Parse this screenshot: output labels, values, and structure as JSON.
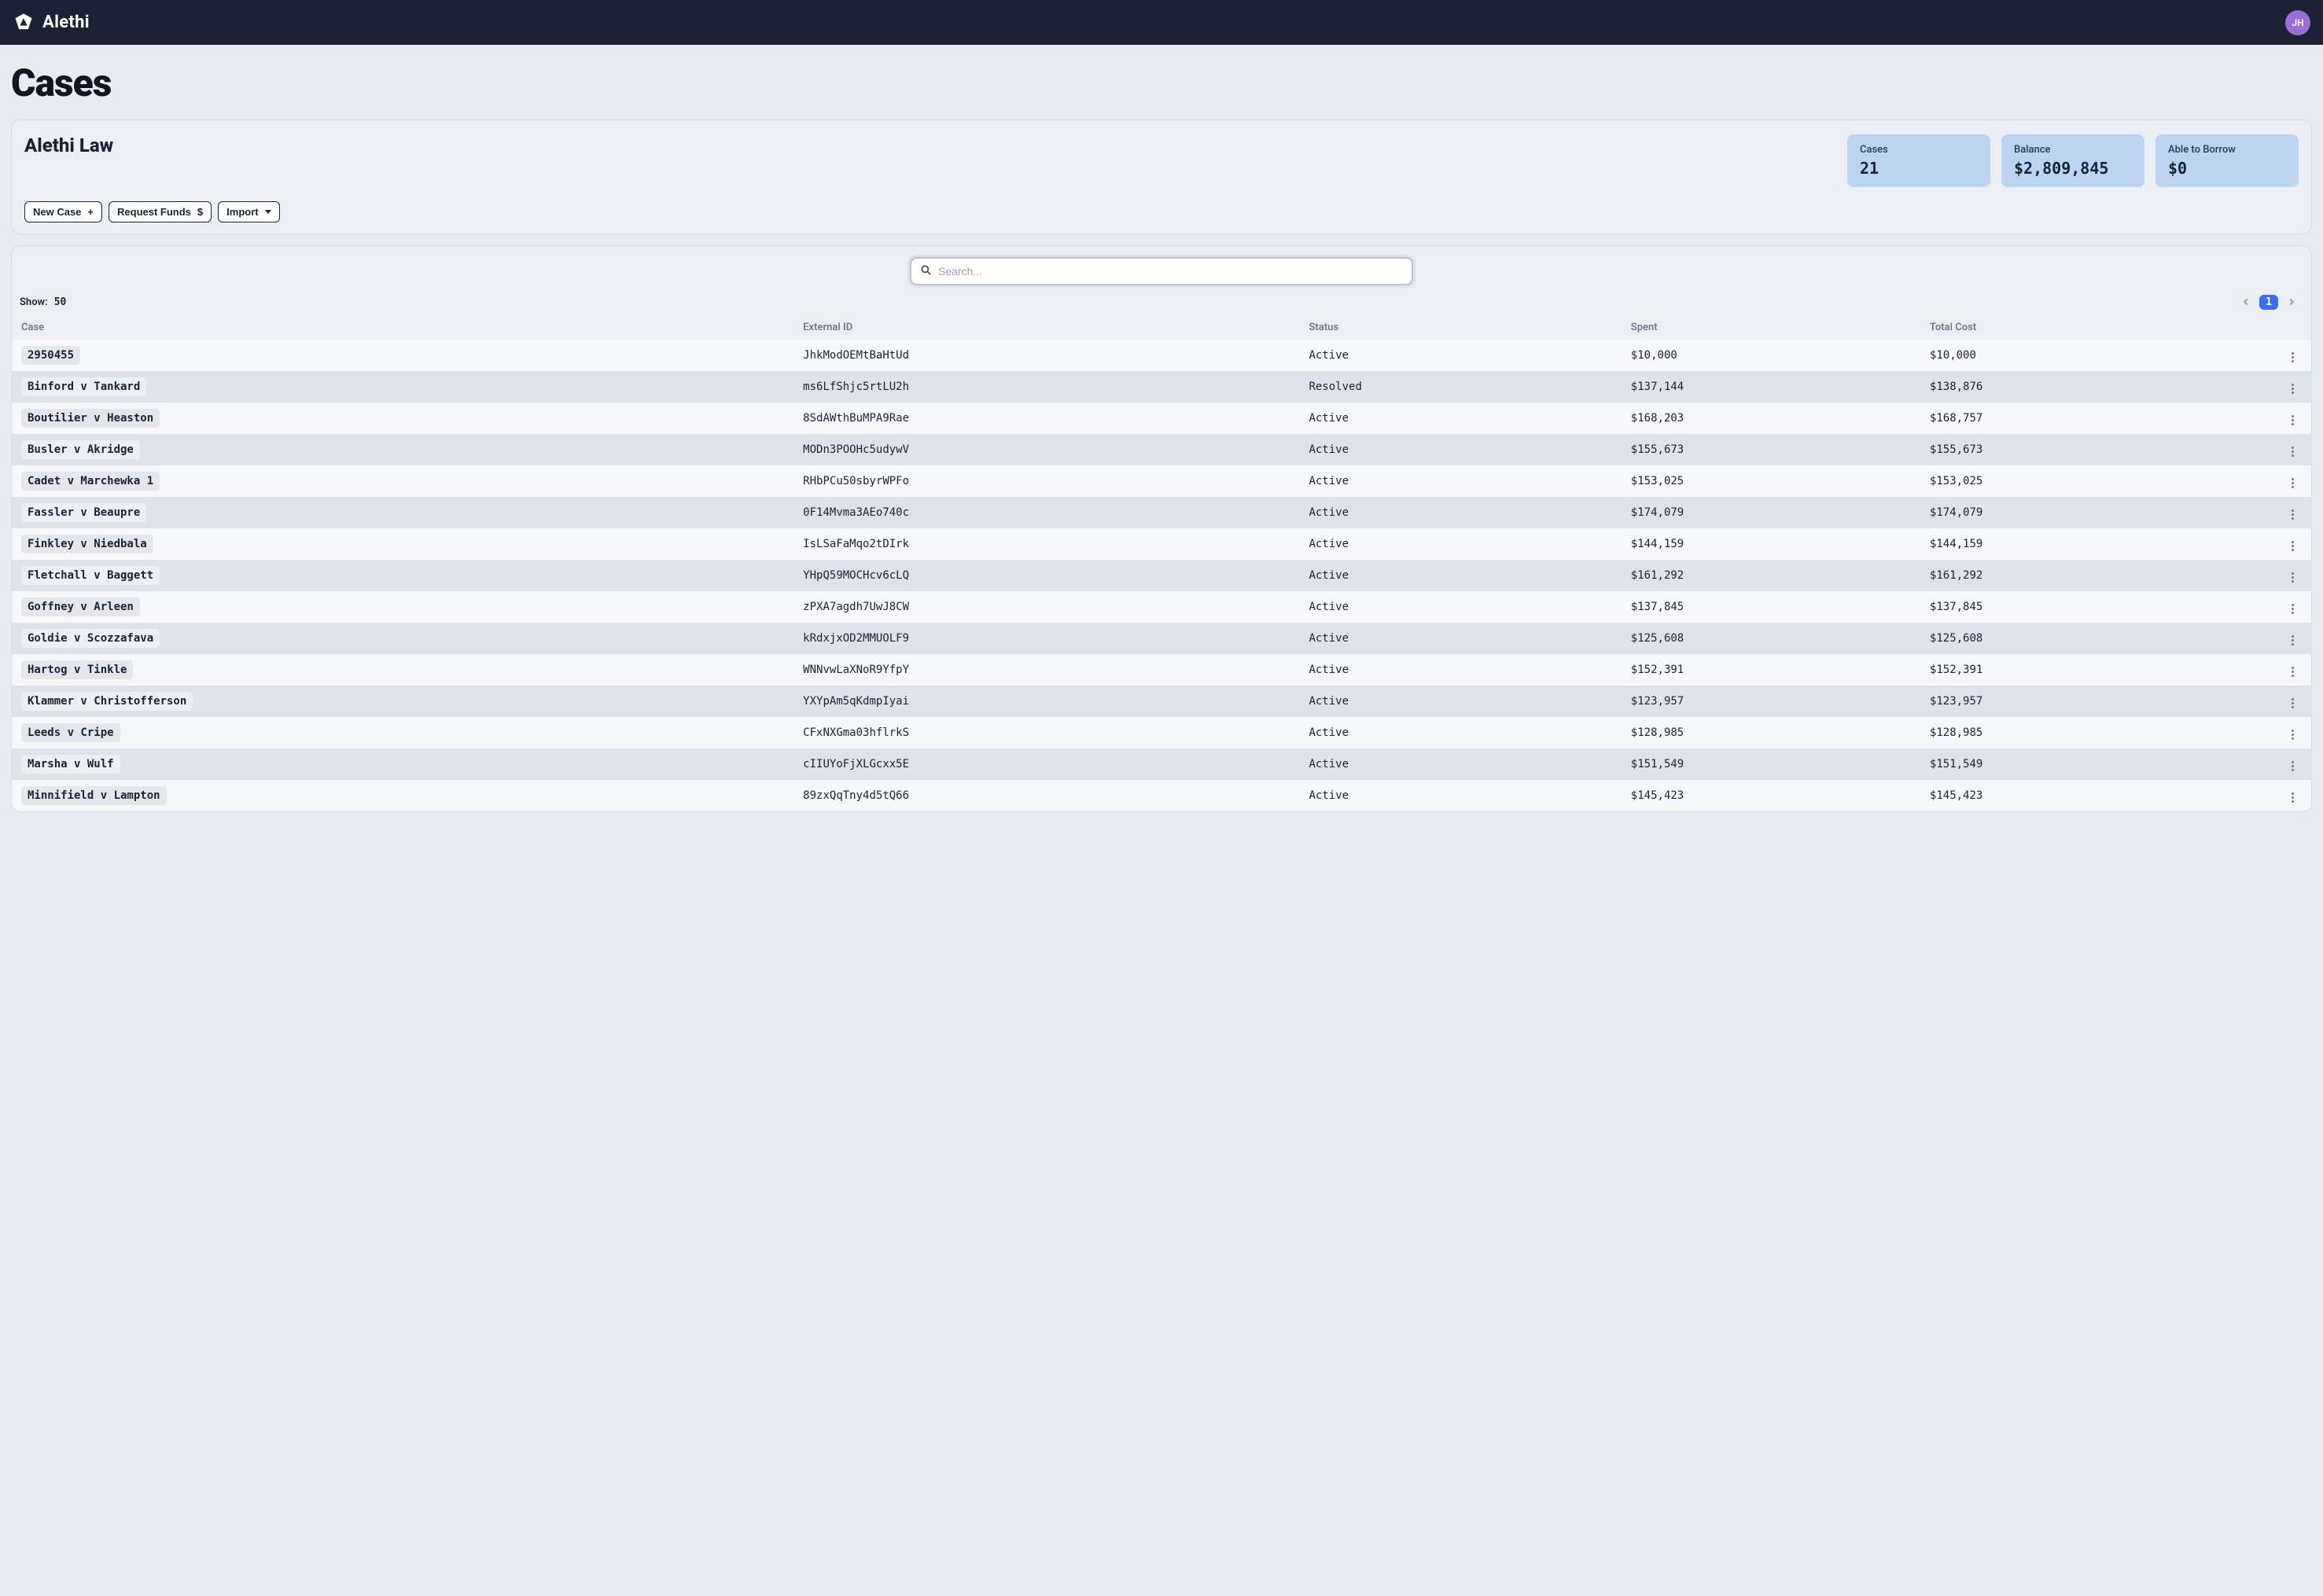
{
  "brand": {
    "name": "Alethi"
  },
  "user": {
    "initials": "JH"
  },
  "page": {
    "title": "Cases"
  },
  "org": {
    "name": "Alethi Law",
    "stats": {
      "cases": {
        "label": "Cases",
        "value": "21"
      },
      "balance": {
        "label": "Balance",
        "value": "$2,809,845"
      },
      "borrow": {
        "label": "Able to Borrow",
        "value": "$0"
      }
    },
    "actions": {
      "new_case": "New Case",
      "request_funds": "Request Funds",
      "import": "Import"
    }
  },
  "table": {
    "search_placeholder": "Search...",
    "show_label": "Show:",
    "show_value": "50",
    "page_current": "1",
    "columns": {
      "case": "Case",
      "external_id": "External ID",
      "status": "Status",
      "spent": "Spent",
      "total_cost": "Total Cost"
    },
    "rows": [
      {
        "case": "2950455",
        "external_id": "JhkModOEMtBaHtUd",
        "status": "Active",
        "spent": "$10,000",
        "total_cost": "$10,000"
      },
      {
        "case": "Binford v Tankard",
        "external_id": "ms6LfShjc5rtLU2h",
        "status": "Resolved",
        "spent": "$137,144",
        "total_cost": "$138,876"
      },
      {
        "case": "Boutilier v Heaston",
        "external_id": "8SdAWthBuMPA9Rae",
        "status": "Active",
        "spent": "$168,203",
        "total_cost": "$168,757"
      },
      {
        "case": "Busler v Akridge",
        "external_id": "MODn3POOHc5udywV",
        "status": "Active",
        "spent": "$155,673",
        "total_cost": "$155,673"
      },
      {
        "case": "Cadet v Marchewka 1",
        "external_id": "RHbPCu50sbyrWPFo",
        "status": "Active",
        "spent": "$153,025",
        "total_cost": "$153,025"
      },
      {
        "case": "Fassler v Beaupre",
        "external_id": "0F14Mvma3AEo740c",
        "status": "Active",
        "spent": "$174,079",
        "total_cost": "$174,079"
      },
      {
        "case": "Finkley v Niedbala",
        "external_id": "IsLSaFaMqo2tDIrk",
        "status": "Active",
        "spent": "$144,159",
        "total_cost": "$144,159"
      },
      {
        "case": "Fletchall v Baggett",
        "external_id": "YHpQ59MOCHcv6cLQ",
        "status": "Active",
        "spent": "$161,292",
        "total_cost": "$161,292"
      },
      {
        "case": "Goffney v Arleen",
        "external_id": "zPXA7agdh7UwJ8CW",
        "status": "Active",
        "spent": "$137,845",
        "total_cost": "$137,845"
      },
      {
        "case": "Goldie v Scozzafava",
        "external_id": "kRdxjxOD2MMUOLF9",
        "status": "Active",
        "spent": "$125,608",
        "total_cost": "$125,608"
      },
      {
        "case": "Hartog v Tinkle",
        "external_id": "WNNvwLaXNoR9YfpY",
        "status": "Active",
        "spent": "$152,391",
        "total_cost": "$152,391"
      },
      {
        "case": "Klammer v Christofferson",
        "external_id": "YXYpAm5qKdmpIyai",
        "status": "Active",
        "spent": "$123,957",
        "total_cost": "$123,957"
      },
      {
        "case": "Leeds v Cripe",
        "external_id": "CFxNXGma03hflrkS",
        "status": "Active",
        "spent": "$128,985",
        "total_cost": "$128,985"
      },
      {
        "case": "Marsha v Wulf",
        "external_id": "cIIUYoFjXLGcxx5E",
        "status": "Active",
        "spent": "$151,549",
        "total_cost": "$151,549"
      },
      {
        "case": "Minnifield v Lampton",
        "external_id": "89zxQqTny4d5tQ66",
        "status": "Active",
        "spent": "$145,423",
        "total_cost": "$145,423"
      }
    ]
  }
}
